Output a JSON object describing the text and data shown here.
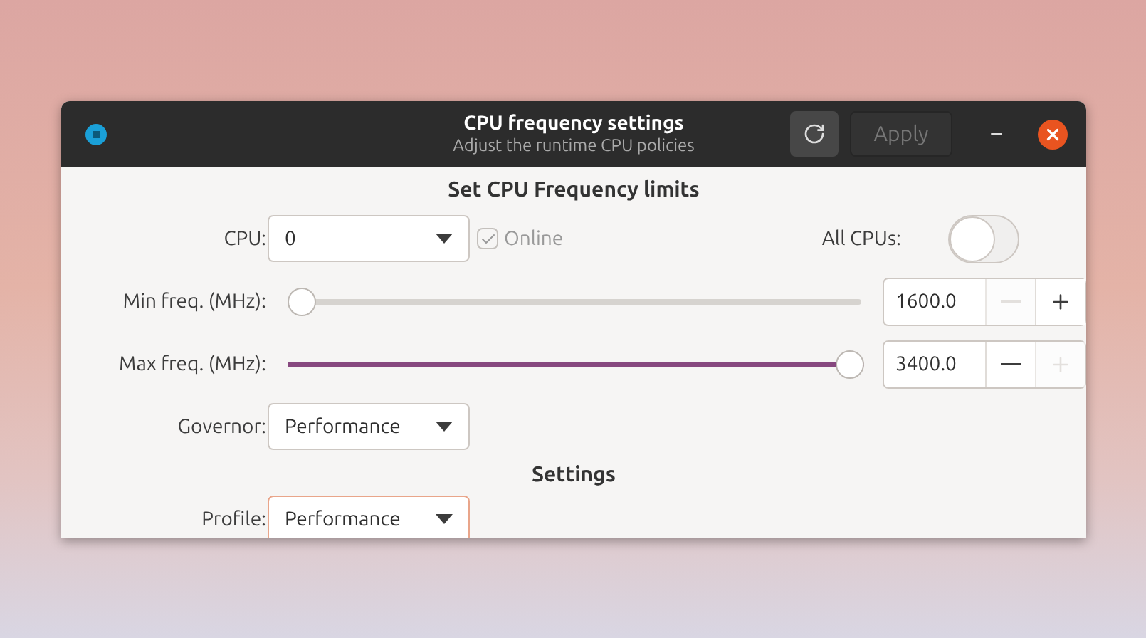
{
  "window": {
    "title": "CPU frequency settings",
    "subtitle": "Adjust the runtime CPU policies",
    "apply_button": {
      "label": "Apply",
      "disabled": true
    }
  },
  "limits": {
    "heading": "Set CPU Frequency limits",
    "cpu": {
      "label": "CPU:",
      "value": "0"
    },
    "online": {
      "label": "Online",
      "checked": true,
      "disabled": true
    },
    "all_cpus": {
      "label": "All CPUs:",
      "on": false
    },
    "sliders": [
      {
        "label": "Min freq. (MHz):",
        "level": 0,
        "value": "1600.0",
        "minus_disabled": true,
        "plus_disabled": false
      },
      {
        "label": "Max freq. (MHz):",
        "level": 1,
        "value": "3400.0",
        "minus_disabled": false,
        "plus_disabled": true
      }
    ],
    "governor": {
      "label": "Governor:",
      "value": "Performance",
      "focused": false
    }
  },
  "settings": {
    "heading": "Settings",
    "profile": {
      "label": "Profile:",
      "value": "Performance",
      "focused": true
    }
  }
}
